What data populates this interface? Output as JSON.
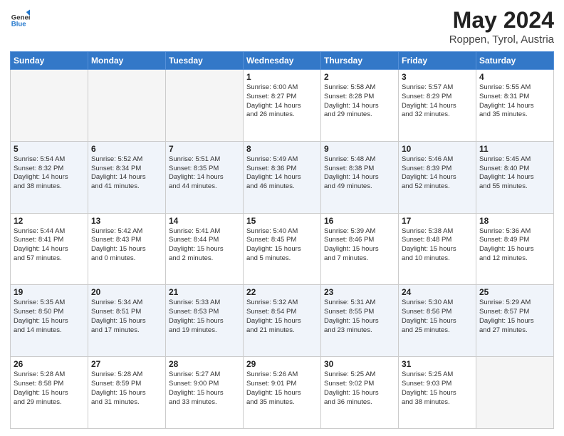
{
  "header": {
    "logo_general": "General",
    "logo_blue": "Blue",
    "title": "May 2024",
    "location": "Roppen, Tyrol, Austria"
  },
  "columns": [
    "Sunday",
    "Monday",
    "Tuesday",
    "Wednesday",
    "Thursday",
    "Friday",
    "Saturday"
  ],
  "weeks": [
    [
      {
        "day": "",
        "info": ""
      },
      {
        "day": "",
        "info": ""
      },
      {
        "day": "",
        "info": ""
      },
      {
        "day": "1",
        "info": "Sunrise: 6:00 AM\nSunset: 8:27 PM\nDaylight: 14 hours\nand 26 minutes."
      },
      {
        "day": "2",
        "info": "Sunrise: 5:58 AM\nSunset: 8:28 PM\nDaylight: 14 hours\nand 29 minutes."
      },
      {
        "day": "3",
        "info": "Sunrise: 5:57 AM\nSunset: 8:29 PM\nDaylight: 14 hours\nand 32 minutes."
      },
      {
        "day": "4",
        "info": "Sunrise: 5:55 AM\nSunset: 8:31 PM\nDaylight: 14 hours\nand 35 minutes."
      }
    ],
    [
      {
        "day": "5",
        "info": "Sunrise: 5:54 AM\nSunset: 8:32 PM\nDaylight: 14 hours\nand 38 minutes."
      },
      {
        "day": "6",
        "info": "Sunrise: 5:52 AM\nSunset: 8:34 PM\nDaylight: 14 hours\nand 41 minutes."
      },
      {
        "day": "7",
        "info": "Sunrise: 5:51 AM\nSunset: 8:35 PM\nDaylight: 14 hours\nand 44 minutes."
      },
      {
        "day": "8",
        "info": "Sunrise: 5:49 AM\nSunset: 8:36 PM\nDaylight: 14 hours\nand 46 minutes."
      },
      {
        "day": "9",
        "info": "Sunrise: 5:48 AM\nSunset: 8:38 PM\nDaylight: 14 hours\nand 49 minutes."
      },
      {
        "day": "10",
        "info": "Sunrise: 5:46 AM\nSunset: 8:39 PM\nDaylight: 14 hours\nand 52 minutes."
      },
      {
        "day": "11",
        "info": "Sunrise: 5:45 AM\nSunset: 8:40 PM\nDaylight: 14 hours\nand 55 minutes."
      }
    ],
    [
      {
        "day": "12",
        "info": "Sunrise: 5:44 AM\nSunset: 8:41 PM\nDaylight: 14 hours\nand 57 minutes."
      },
      {
        "day": "13",
        "info": "Sunrise: 5:42 AM\nSunset: 8:43 PM\nDaylight: 15 hours\nand 0 minutes."
      },
      {
        "day": "14",
        "info": "Sunrise: 5:41 AM\nSunset: 8:44 PM\nDaylight: 15 hours\nand 2 minutes."
      },
      {
        "day": "15",
        "info": "Sunrise: 5:40 AM\nSunset: 8:45 PM\nDaylight: 15 hours\nand 5 minutes."
      },
      {
        "day": "16",
        "info": "Sunrise: 5:39 AM\nSunset: 8:46 PM\nDaylight: 15 hours\nand 7 minutes."
      },
      {
        "day": "17",
        "info": "Sunrise: 5:38 AM\nSunset: 8:48 PM\nDaylight: 15 hours\nand 10 minutes."
      },
      {
        "day": "18",
        "info": "Sunrise: 5:36 AM\nSunset: 8:49 PM\nDaylight: 15 hours\nand 12 minutes."
      }
    ],
    [
      {
        "day": "19",
        "info": "Sunrise: 5:35 AM\nSunset: 8:50 PM\nDaylight: 15 hours\nand 14 minutes."
      },
      {
        "day": "20",
        "info": "Sunrise: 5:34 AM\nSunset: 8:51 PM\nDaylight: 15 hours\nand 17 minutes."
      },
      {
        "day": "21",
        "info": "Sunrise: 5:33 AM\nSunset: 8:53 PM\nDaylight: 15 hours\nand 19 minutes."
      },
      {
        "day": "22",
        "info": "Sunrise: 5:32 AM\nSunset: 8:54 PM\nDaylight: 15 hours\nand 21 minutes."
      },
      {
        "day": "23",
        "info": "Sunrise: 5:31 AM\nSunset: 8:55 PM\nDaylight: 15 hours\nand 23 minutes."
      },
      {
        "day": "24",
        "info": "Sunrise: 5:30 AM\nSunset: 8:56 PM\nDaylight: 15 hours\nand 25 minutes."
      },
      {
        "day": "25",
        "info": "Sunrise: 5:29 AM\nSunset: 8:57 PM\nDaylight: 15 hours\nand 27 minutes."
      }
    ],
    [
      {
        "day": "26",
        "info": "Sunrise: 5:28 AM\nSunset: 8:58 PM\nDaylight: 15 hours\nand 29 minutes."
      },
      {
        "day": "27",
        "info": "Sunrise: 5:28 AM\nSunset: 8:59 PM\nDaylight: 15 hours\nand 31 minutes."
      },
      {
        "day": "28",
        "info": "Sunrise: 5:27 AM\nSunset: 9:00 PM\nDaylight: 15 hours\nand 33 minutes."
      },
      {
        "day": "29",
        "info": "Sunrise: 5:26 AM\nSunset: 9:01 PM\nDaylight: 15 hours\nand 35 minutes."
      },
      {
        "day": "30",
        "info": "Sunrise: 5:25 AM\nSunset: 9:02 PM\nDaylight: 15 hours\nand 36 minutes."
      },
      {
        "day": "31",
        "info": "Sunrise: 5:25 AM\nSunset: 9:03 PM\nDaylight: 15 hours\nand 38 minutes."
      },
      {
        "day": "",
        "info": ""
      }
    ]
  ]
}
